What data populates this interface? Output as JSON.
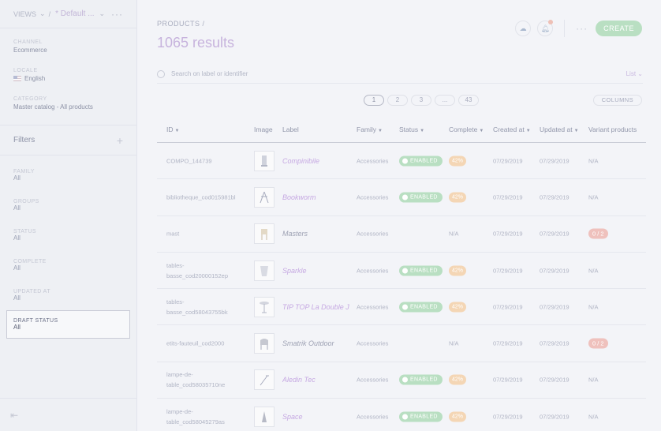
{
  "sidebar": {
    "views_label": "VIEWS",
    "view_selected": "* Default ...",
    "channel": {
      "label": "CHANNEL",
      "value": "Ecommerce"
    },
    "locale": {
      "label": "LOCALE",
      "value": "English"
    },
    "category": {
      "label": "CATEGORY",
      "value": "Master catalog - All products"
    },
    "filters_title": "Filters",
    "filters": [
      {
        "label": "FAMILY",
        "value": "All"
      },
      {
        "label": "GROUPS",
        "value": "All"
      },
      {
        "label": "STATUS",
        "value": "All"
      },
      {
        "label": "COMPLETE",
        "value": "All"
      },
      {
        "label": "UPDATED AT",
        "value": "All"
      },
      {
        "label": "DRAFT STATUS",
        "value": "All"
      }
    ]
  },
  "header": {
    "breadcrumb": "PRODUCTS /",
    "results": "1065 results",
    "create_label": "CREATE"
  },
  "search": {
    "placeholder": "Search on label or identifier",
    "display_mode": "List"
  },
  "pagination": {
    "pages": [
      "1",
      "2",
      "3",
      "...",
      "43"
    ],
    "current": "1"
  },
  "columns_label": "COLUMNS",
  "table": {
    "headers": [
      "ID",
      "Image",
      "Label",
      "Family",
      "Status",
      "Complete",
      "Created at",
      "Updated at",
      "Variant products"
    ],
    "rows": [
      {
        "id": "COMPO_144739",
        "label": "Compinibile",
        "family": "Accessories",
        "status": "ENABLED",
        "complete": "42%",
        "created": "07/29/2019",
        "updated": "07/29/2019",
        "variant": "N/A",
        "icon": "lamp-icon"
      },
      {
        "id": "bibliotheque_cod015981bl",
        "label": "Bookworm",
        "family": "Accessories",
        "status": "ENABLED",
        "complete": "42%",
        "created": "07/29/2019",
        "updated": "07/29/2019",
        "variant": "N/A",
        "icon": "shelf-icon"
      },
      {
        "id": "mast",
        "label": "Masters",
        "family": "Accessories",
        "status": "",
        "complete": "N/A",
        "created": "07/29/2019",
        "updated": "07/29/2019",
        "variant": "0 / 2",
        "icon": "chair-icon"
      },
      {
        "id": "tables-basse_cod20000152ep",
        "label": "Sparkle",
        "family": "Accessories",
        "status": "ENABLED",
        "complete": "42%",
        "created": "07/29/2019",
        "updated": "07/29/2019",
        "variant": "N/A",
        "icon": "table-icon"
      },
      {
        "id": "tables-basse_cod58043755bk",
        "label": "TIP TOP La Double J",
        "family": "Accessories",
        "status": "ENABLED",
        "complete": "42%",
        "created": "07/29/2019",
        "updated": "07/29/2019",
        "variant": "N/A",
        "icon": "side-table-icon"
      },
      {
        "id": "etits-fauteuil_cod2000",
        "label": "Smatrik Outdoor",
        "family": "Accessories",
        "status": "",
        "complete": "N/A",
        "created": "07/29/2019",
        "updated": "07/29/2019",
        "variant": "0 / 2",
        "icon": "armchair-icon"
      },
      {
        "id": "lampe-de-table_cod58035710ne",
        "label": "Aledin Tec",
        "family": "Accessories",
        "status": "ENABLED",
        "complete": "42%",
        "created": "07/29/2019",
        "updated": "07/29/2019",
        "variant": "N/A",
        "icon": "desk-lamp-icon"
      },
      {
        "id": "lampe-de-table_cod58045279as",
        "label": "Space",
        "family": "Accessories",
        "status": "ENABLED",
        "complete": "42%",
        "created": "07/29/2019",
        "updated": "07/29/2019",
        "variant": "N/A",
        "icon": "cone-lamp-icon"
      }
    ]
  }
}
